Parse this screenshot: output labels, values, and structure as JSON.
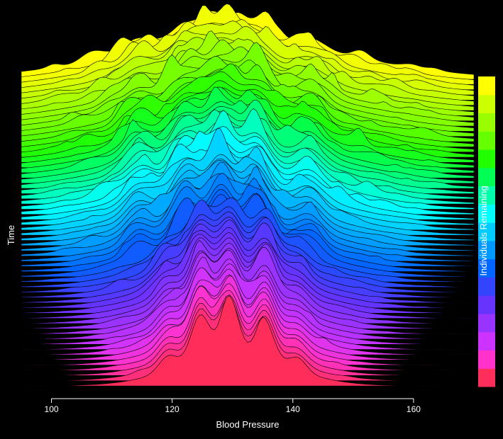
{
  "chart_data": {
    "type": "area",
    "style": "ridgeline",
    "title": "",
    "xlabel": "Blood Pressure",
    "ylabel": "Time",
    "xlim": [
      95,
      170
    ],
    "xticks": [
      100,
      120,
      140,
      160
    ],
    "colorbar_label": "Individuals Remaining",
    "colorbar_colors": [
      "#ff2d5a",
      "#ff33cc",
      "#cc33ff",
      "#9933ff",
      "#6633ff",
      "#3344ff",
      "#0066ff",
      "#0099ff",
      "#00ccff",
      "#00ffff",
      "#00ffaa",
      "#00ff55",
      "#22ff00",
      "#66ff00",
      "#99ff00",
      "#ccff00",
      "#ffff00"
    ],
    "n_layers": 60,
    "front_peaks": [
      {
        "x": 119,
        "height": 0.55
      },
      {
        "x": 124.5,
        "height": 1.0
      },
      {
        "x": 129.5,
        "height": 0.9
      },
      {
        "x": 135.5,
        "height": 0.85
      },
      {
        "x": 141,
        "height": 0.4
      }
    ],
    "back_peaks": [
      {
        "x": 114,
        "height": 0.8
      },
      {
        "x": 122,
        "height": 0.9
      },
      {
        "x": 128,
        "height": 1.0
      },
      {
        "x": 134,
        "height": 0.85
      },
      {
        "x": 143,
        "height": 0.6
      }
    ],
    "grid": false,
    "legend": "colorbar-right"
  }
}
